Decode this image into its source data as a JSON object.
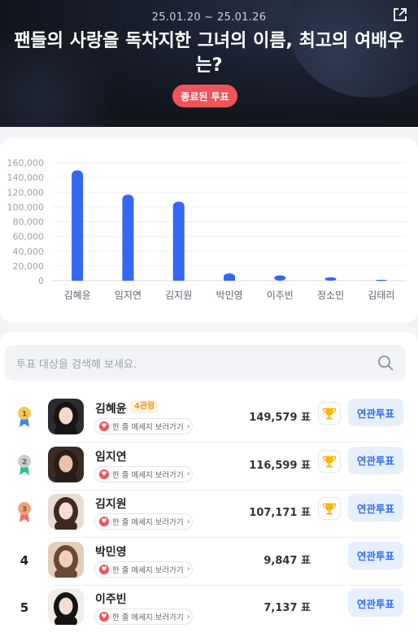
{
  "header": {
    "date_range": "25.01.20 ~ 25.01.26",
    "title": "팬들의 사랑을 독차지한 그녀의 이름, 최고의 여배우는?",
    "status_button": "종료된 투표"
  },
  "chart_data": {
    "type": "bar",
    "categories": [
      "김혜윤",
      "임지연",
      "김지원",
      "박민영",
      "이주빈",
      "정소민",
      "김태리"
    ],
    "values": [
      149579,
      116599,
      107171,
      9847,
      7137,
      4500,
      1200
    ],
    "ylim": [
      0,
      160000
    ],
    "yticks": [
      "0",
      "20,000",
      "40,000",
      "60,000",
      "80,000",
      "100,000",
      "120,000",
      "140,000",
      "160,000"
    ],
    "grid": true,
    "color": "#3467f2"
  },
  "search": {
    "placeholder": "투표 대상을 검색해 보세요."
  },
  "ranking": [
    {
      "rank": "1",
      "name": "김혜윤",
      "badge": "4관왕",
      "message": "한 줄 메세지 보러가기",
      "votes": "149,579 표",
      "button": "연관투표",
      "medal_color": "#f3c94e",
      "ribbon_color": "#3b82f6"
    },
    {
      "rank": "2",
      "name": "임지연",
      "badge": "",
      "message": "한 줄 메세지 보러가기",
      "votes": "116,599 표",
      "button": "연관투표",
      "medal_color": "#c9ccd3",
      "ribbon_color": "#22c58b"
    },
    {
      "rank": "3",
      "name": "김지원",
      "badge": "",
      "message": "한 줄 메세지 보러가기",
      "votes": "107,171 표",
      "button": "연관투표",
      "medal_color": "#f3a27a",
      "ribbon_color": "#f06b6b"
    },
    {
      "rank": "4",
      "name": "박민영",
      "badge": "",
      "message": "한 줄 메세지 보러가기",
      "votes": "9,847 표",
      "button": "연관투표"
    },
    {
      "rank": "5",
      "name": "이주빈",
      "badge": "",
      "message": "한 줄 메세지 보러가기",
      "votes": "7,137 표",
      "button": "연관투표"
    }
  ],
  "colors": {
    "accent": "#2e6cf0",
    "ended": "#f0535a",
    "trophy": "#f5b800"
  },
  "icons": [
    "share-icon",
    "search-icon",
    "heart-icon",
    "chevron-right-icon",
    "trophy-icon",
    "medal-icon"
  ]
}
